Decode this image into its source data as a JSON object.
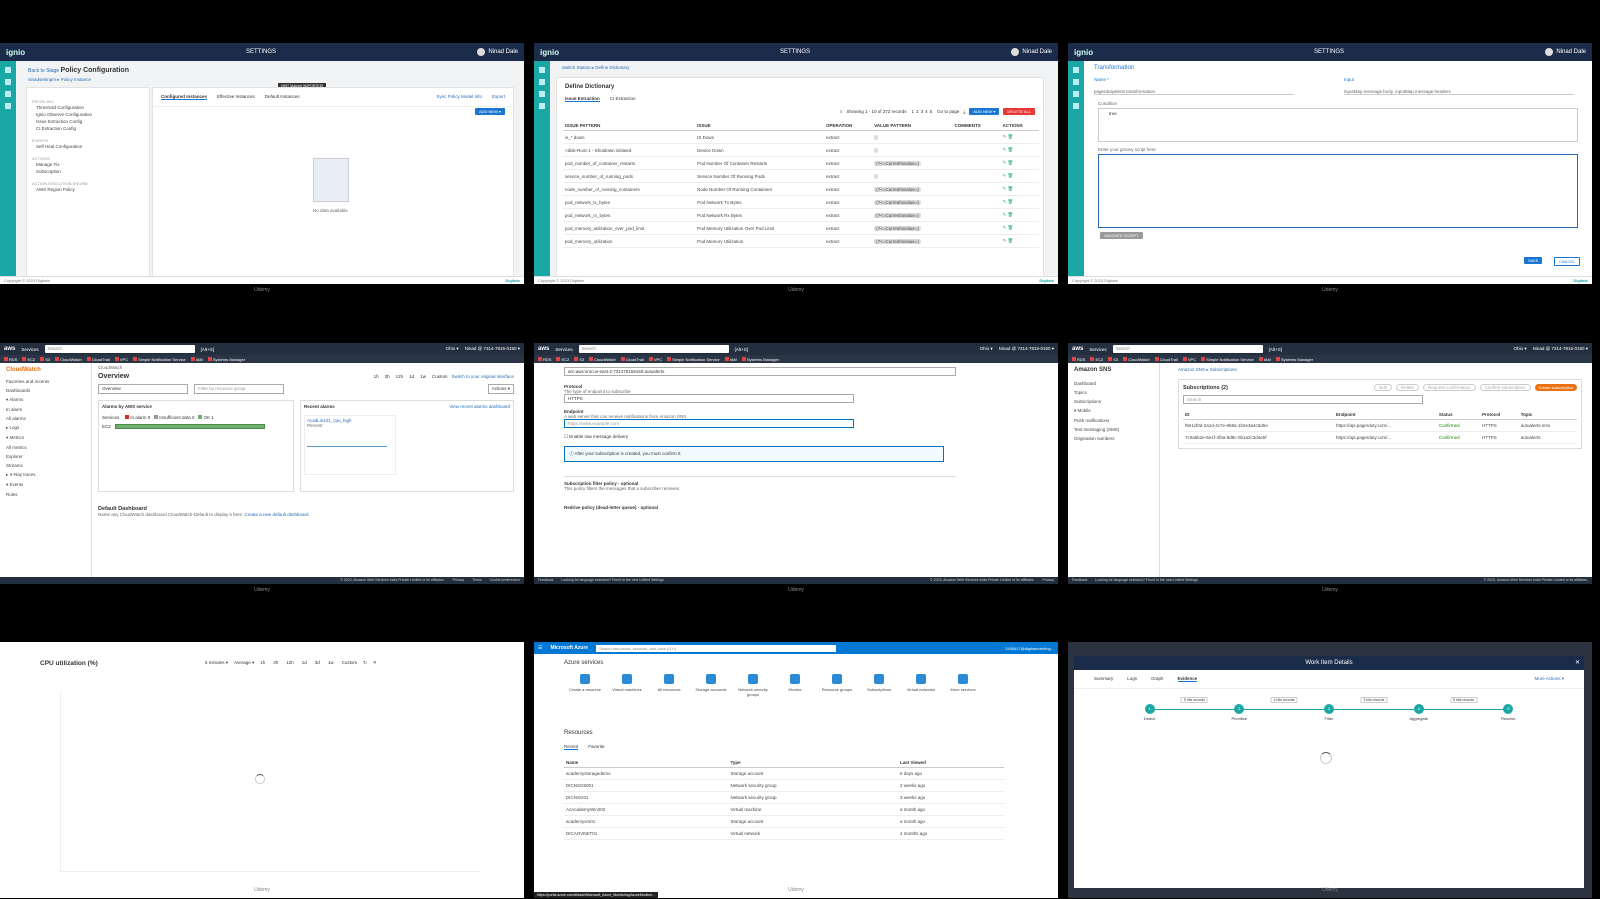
{
  "watermark": "Udemy",
  "t1": {
    "logo": "ignio",
    "settings": "SETTINGS",
    "user": "Ninad Dale",
    "tooltip": "HINT [Admin] [IMPORTED]",
    "back": "Back to Stage",
    "title": "Policy Configuration",
    "crumb": "ninadsetsnpm ▸ Policy Instance",
    "sections": [
      {
        "h": "PROFILING",
        "items": [
          "Threshold Configuration",
          "Ignio Observe Configuration",
          "Issue Extraction Config",
          "CI Extraction Config"
        ]
      },
      {
        "h": "EVENTS",
        "items": [
          "Self Heal Configuration"
        ]
      },
      {
        "h": "ACTIONS",
        "items": [
          "Manage Fix",
          "Subscription"
        ]
      },
      {
        "h": "ACTION EXECUTION ENGINE",
        "items": [
          "AWS Region Policy"
        ]
      }
    ],
    "tabs": [
      "Configured Instances",
      "Effective Instances",
      "Default Instances"
    ],
    "sync": "Sync Policy Model Info",
    "export": "Export",
    "add": "ADD NEW ▾",
    "empty": "No data available",
    "copyright": "Copyright © 2023 Digitate",
    "brand": "Digitate"
  },
  "t2": {
    "crumb": "Switch Station ▸ Define Dictionary",
    "title": "Define Dictionary",
    "tabs": [
      "Issue Extraction",
      "CI Extraction"
    ],
    "showing": "Showing 1 - 10 of 372 records",
    "pages": [
      "1",
      "2",
      "3",
      "4",
      "5"
    ],
    "goto": "Go to page",
    "add": "ADD NEW ▾",
    "del": "DELETE ALL",
    "cols": [
      "ISSUE PATTERN",
      "ISSUE",
      "OPERATION",
      "VALUE PATTERN",
      "COMMENTS",
      "ACTIONS"
    ],
    "rows": [
      [
        "is_* down",
        "IS Down",
        "extract",
        ""
      ],
      [
        "<disk-Root-1 - Shutdown initiated",
        "Device Down",
        "extract",
        ""
      ],
      [
        "pod_number_of_container_restarts",
        "Pod Number Of Container Restarts",
        "extract",
        "(?<=Current\\svalue=)"
      ],
      [
        "service_number_of_running_pods",
        "Service Number Of Running Pods",
        "extract",
        ""
      ],
      [
        "node_number_of_running_containers",
        "Node Number Of Running Containers",
        "extract",
        "(?<=Current\\svalue=)"
      ],
      [
        "pod_network_tx_bytes",
        "Pod Network Tx Bytes",
        "extract",
        "(?<=Current\\svalue=)"
      ],
      [
        "pod_network_rx_bytes",
        "Pod Network Rx Bytes",
        "extract",
        "(?<=Current\\svalue=)"
      ],
      [
        "pod_memory_utilization_over_pod_limit",
        "Pod Memory Utilization Over Pod Limit",
        "extract",
        "(?<=Current\\svalue=)"
      ],
      [
        "pod_memory_utilization",
        "Pod Memory Utilization",
        "extract",
        "(?<=Current\\svalue=)"
      ]
    ]
  },
  "t3": {
    "title": "Transformation",
    "name_label": "Name *",
    "name_val": "pagerdutyalerts transformation",
    "input_label": "Input",
    "input_val": "inputMap.message.body, inputMap.message.headers",
    "cond_label": "Condition",
    "cond_val": "true",
    "groovy_label": "Enter your groovy script here",
    "validate": "VALIDATE SCRIPT",
    "save": "SAVE",
    "cancel": "CANCEL"
  },
  "t4": {
    "search": "Search",
    "shortcut": "[Alt+S]",
    "region": "Ohio ▾",
    "account": "Ninad @ 7314-7815-0150 ▾",
    "favs": [
      "RDS",
      "EC2",
      "S3",
      "CloudWatch",
      "CloudTrail",
      "VPC",
      "Simple Notification Service",
      "IAM",
      "Systems Manager"
    ],
    "side_title": "CloudWatch",
    "side": [
      "Favorites and recents",
      "Dashboards",
      "▾ Alarms",
      "In alarm",
      "All alarms",
      "▸ Logs",
      "▾ Metrics",
      "All metrics",
      "Explorer",
      "Streams",
      "▸ X-Ray traces",
      "▾ Events",
      "Rules"
    ],
    "crumb": "CloudWatch",
    "overview": "Overview",
    "switch": "Switch to your original interface",
    "ranges": [
      "1h",
      "3h",
      "12h",
      "1d",
      "1w",
      "Custom"
    ],
    "actions": "Actions ▾",
    "filter": "Filter by resource group",
    "abs": "Alarms by AWS service",
    "services": "Services",
    "legend": [
      "In alarm 0",
      "Insufficient data 0",
      "OK 1"
    ],
    "ec2": "EC2",
    "recent": "Recent alarms",
    "recent_link": "View recent alarms dashboard",
    "alarm": "AcadLin101_cpu_high",
    "percent": "Percent",
    "default_dash": "Default Dashboard",
    "dash_note": "Name any CloudWatch dashboard CloudWatch-Default to display it here.",
    "dash_link": "Create a new default dashboard",
    "copy": "© 2023, Amazon Web Services India Private Limited or its affiliates.",
    "privacy": "Privacy",
    "terms": "Terms",
    "cookies": "Cookie preferences"
  },
  "t5": {
    "topic": "arn:aws:sns:us-east-2:731478159150:autoalerts",
    "protocol_label": "Protocol",
    "protocol_hint": "The type of endpoint to subscribe",
    "protocol": "HTTPS",
    "endpoint_label": "Endpoint",
    "endpoint_hint": "A web server that can receive notifications from Amazon SNS",
    "endpoint": "https://www.example.com",
    "raw": "Enable raw message delivery",
    "notice": "After your subscription is created, you must confirm it.",
    "filter": "Subscription filter policy - optional",
    "filter_hint": "This policy filters the messages that a subscriber receives.",
    "redrive": "Redrive policy (dead-letter queue) - optional",
    "feedback": "Feedback",
    "lang": "Looking for language selection? Find it in the new Unified Settings"
  },
  "t6": {
    "side_title": "Amazon SNS",
    "side": [
      "Dashboard",
      "Topics",
      "Subscriptions",
      "▾ Mobile",
      "Push notifications",
      "Text messaging (SMS)",
      "Origination numbers"
    ],
    "crumb": "Amazon SNS ▸ Subscriptions",
    "title": "Subscriptions (2)",
    "buttons": [
      "Edit",
      "Delete",
      "Request confirmation",
      "Confirm subscription"
    ],
    "create": "Create subscription",
    "search": "Search",
    "cols": [
      "ID",
      "Endpoint",
      "Status",
      "Protocol",
      "Topic"
    ],
    "rows": [
      [
        "f8e1cf0d-2a1d-4c7e-9b8a-1b2e3a4c5d6e",
        "https://api.pagerduty.com/...",
        "Confirmed",
        "HTTPS",
        "autoalerts-sms"
      ],
      [
        "7c0a6b2e-5e1f-4f3a-8d9c-0b1a2c3d4e5f",
        "https://api.pagerduty.com/...",
        "Confirmed",
        "HTTPS",
        "autoalerts"
      ]
    ]
  },
  "t7": {
    "title": "CPU utilization (%)",
    "period": "5 minutes ▾",
    "stat": "Average ▾",
    "ranges": [
      "1h",
      "3h",
      "12h",
      "1d",
      "3d",
      "1w",
      "Custom"
    ]
  },
  "t8": {
    "brand": "Microsoft Azure",
    "search": "Search resources, services, and docs (G+/)",
    "user": "2435417@digitateventing...",
    "services_title": "Azure services",
    "services": [
      "Create a resource",
      "Virtual machines",
      "All resources",
      "Storage accounts",
      "Network security groups",
      "Monitor",
      "Resource groups",
      "Subscriptions",
      "Virtual networks",
      "More services"
    ],
    "resources_title": "Resources",
    "tabs": [
      "Recent",
      "Favorite"
    ],
    "cols": [
      "Name",
      "Type",
      "Last Viewed"
    ],
    "rows": [
      [
        "academystoragedemo",
        "Storage account",
        "6 days ago"
      ],
      [
        "DICNSG5001",
        "Network security group",
        "2 weeks ago"
      ],
      [
        "DICNSG01",
        "Network security group",
        "3 weeks ago"
      ],
      [
        "AzAcademyWin202",
        "Virtual machine",
        "a month ago"
      ],
      [
        "academyvm01",
        "Storage account",
        "a month ago"
      ],
      [
        "DICAOVNET01",
        "Virtual network",
        "4 months ago"
      ]
    ],
    "status": "https://portal.azure.com/#blade/Microsoft_Azure_Monitoring/AzureMonitori..."
  },
  "t9": {
    "title": "Work Item Details",
    "tabs": [
      "Summary",
      "Logs",
      "Graph",
      "Evidence"
    ],
    "more": "More Actions ▾",
    "steps": [
      "Detect",
      "Prioritize",
      "Filter",
      "Aggregate",
      "Resolve"
    ],
    "badges": [
      "5 hits records",
      "4 hits records",
      "3 hits records",
      "5 hits records"
    ]
  }
}
